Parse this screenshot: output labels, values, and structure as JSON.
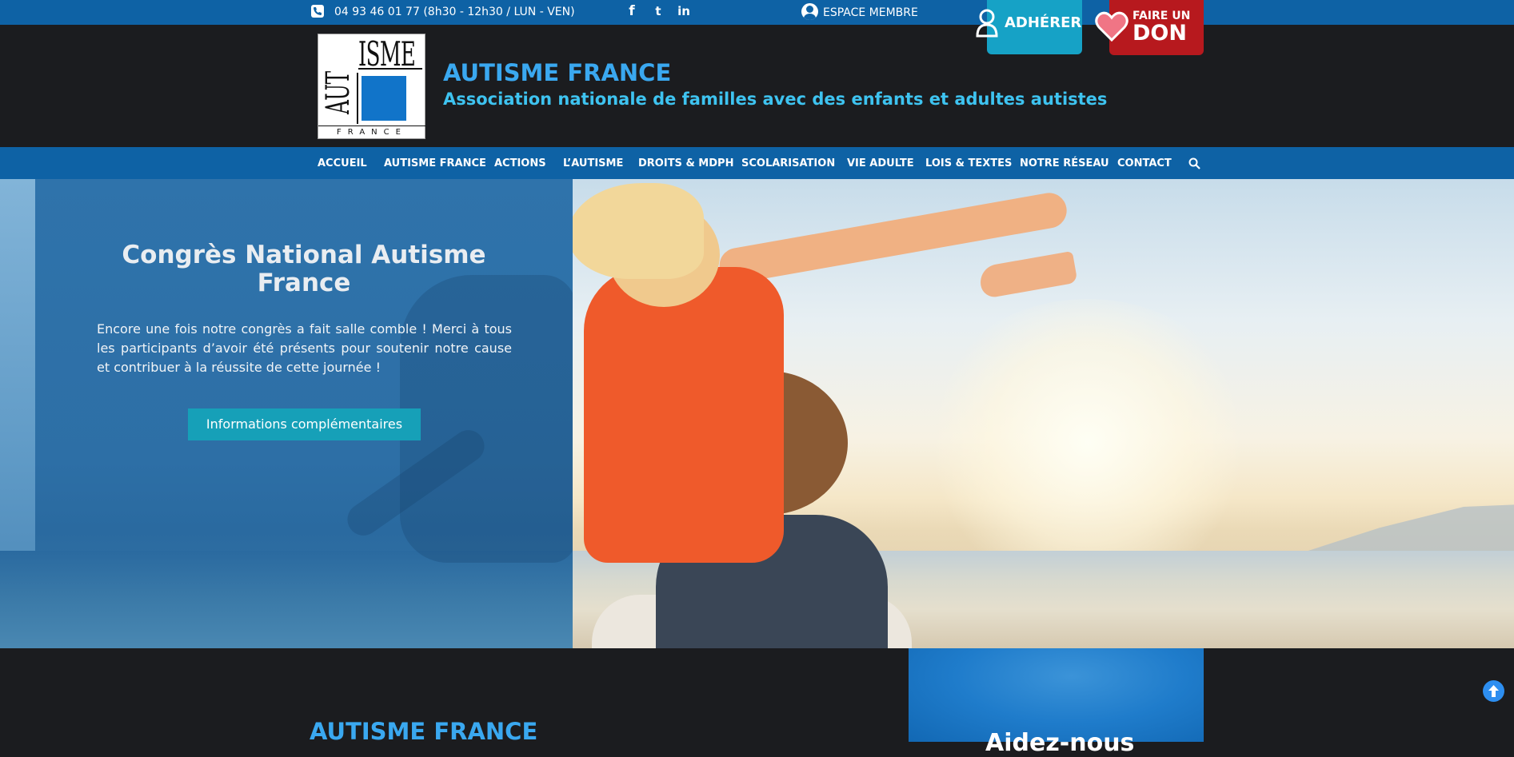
{
  "topbar": {
    "phone": "04 93 46 01 77 (8h30 - 12h30 / LUN - VEN)",
    "social": [
      {
        "icon": "facebook-icon",
        "glyph": "f"
      },
      {
        "icon": "twitter-icon",
        "glyph": "t"
      },
      {
        "icon": "linkedin-icon",
        "glyph": "in"
      }
    ],
    "member_label": "ESPACE MEMBRE",
    "adherer_label": "ADHÉRER",
    "don_small": "FAIRE UN",
    "don_big": "DON"
  },
  "header": {
    "logo": {
      "top": "ISME",
      "side": "AUT",
      "bottom": "FRANCE"
    },
    "title": "AUTISME FRANCE",
    "tagline": "Association nationale de familles avec des enfants et adultes autistes"
  },
  "nav": {
    "items": [
      "ACCUEIL",
      "AUTISME FRANCE",
      "ACTIONS",
      "L’AUTISME",
      "DROITS & MDPH",
      "SCOLARISATION",
      "VIE ADULTE",
      "LOIS & TEXTES",
      "NOTRE RÉSEAU",
      "CONTACT"
    ]
  },
  "hero": {
    "title": "Congrès National Autisme France",
    "text": "Encore une fois notre congrès a fait salle comble ! Merci à tous les participants d’avoir été présents pour soutenir notre cause et contribuer à la réussite de cette journée !",
    "button": "Informations complémentaires"
  },
  "bottom": {
    "title": "AUTISME FRANCE",
    "help": "Aidez-nous"
  },
  "colors": {
    "topbar": "#0e62a5",
    "header_bg": "#1b1c1f",
    "title_blue": "#3aa8f0",
    "adherer": "#16a2c6",
    "don": "#b7191e",
    "hero_button": "#16a0b8"
  }
}
